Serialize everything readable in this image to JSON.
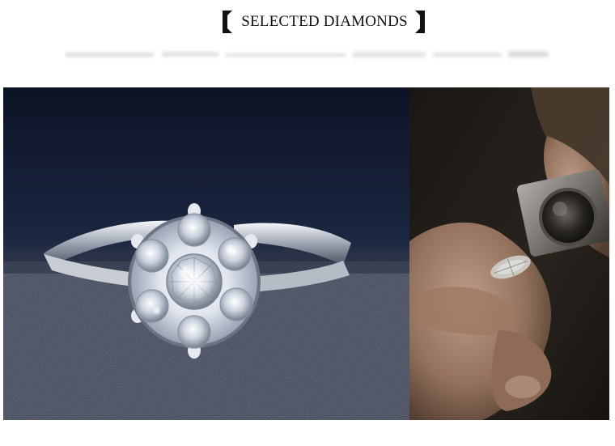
{
  "heading": {
    "title": "SELECTED DIAMONDS"
  },
  "images": {
    "left": "solitaire-halo-ring-photo",
    "right": "jeweler-inspecting-diamond-with-loupe-photo"
  },
  "colors": {
    "bracket": "#111111",
    "background": "#ffffff",
    "ring_backdrop": "#1d2740",
    "jeweler_backdrop": "#2a241e"
  }
}
